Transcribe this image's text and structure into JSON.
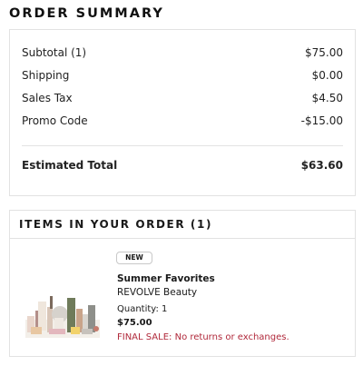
{
  "page_title": "ORDER SUMMARY",
  "summary": {
    "subtotal": {
      "label": "Subtotal (1)",
      "value": "$75.00"
    },
    "shipping": {
      "label": "Shipping",
      "value": "$0.00"
    },
    "sales_tax": {
      "label": "Sales Tax",
      "value": "$4.50"
    },
    "promo_code": {
      "label": "Promo Code",
      "value": "-$15.00"
    },
    "estimated_total": {
      "label": "Estimated Total",
      "value": "$63.60"
    }
  },
  "items": {
    "title": "ITEMS IN YOUR ORDER (1)",
    "list": [
      {
        "badge": "NEW",
        "name": "Summer Favorites",
        "brand": "REVOLVE Beauty",
        "quantity_label": "Quantity:",
        "quantity": "1",
        "price": "$75.00",
        "notice": "FINAL SALE: No returns or exchanges.",
        "image_icon": "beauty-products-image"
      }
    ]
  },
  "colors": {
    "notice": "#b0283a",
    "border": "#e2e2e2"
  }
}
